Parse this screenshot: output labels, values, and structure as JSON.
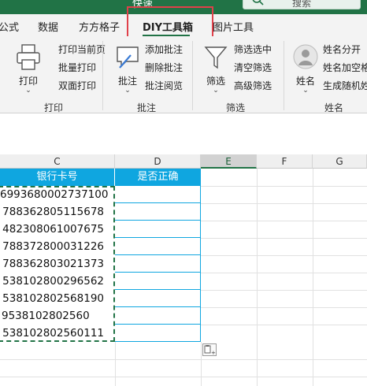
{
  "window": {
    "title": "快速",
    "search_placeholder": "搜索"
  },
  "tabs": [
    {
      "label": "公式"
    },
    {
      "label": "数据"
    },
    {
      "label": "方方格子"
    },
    {
      "label": "DIY工具箱",
      "active": true
    },
    {
      "label": "图片工具"
    }
  ],
  "ribbon": {
    "print_group": {
      "label": "打印",
      "big_button": "打印",
      "items": [
        "打印当前页",
        "批量打印",
        "双面打印"
      ]
    },
    "comment_group": {
      "label": "批注",
      "big_button": "批注",
      "items": [
        "添加批注",
        "删除批注",
        "批注阅览"
      ]
    },
    "filter_group": {
      "label": "筛选",
      "big_button": "筛选",
      "items": [
        "筛选选中",
        "清空筛选",
        "高级筛选"
      ]
    },
    "name_group": {
      "label": "姓名",
      "big_button": "姓名",
      "items": [
        "姓名分开",
        "姓名加空格",
        "生成随机姓"
      ]
    }
  },
  "columns": [
    "C",
    "D",
    "E",
    "F",
    "G"
  ],
  "selected_column": "E",
  "table": {
    "headers": [
      "银行卡号",
      "是否正确"
    ],
    "rows": [
      "6993680002737100",
      "788362805115678",
      "482308061007675",
      "788372800031226",
      "788362803021373",
      "538102800296562",
      "538102802568190",
      "9538102802560",
      "538102802560111"
    ]
  },
  "colors": {
    "accent": "#217346",
    "header_fill": "#0fa6e0",
    "highlight": "#e0404a"
  }
}
